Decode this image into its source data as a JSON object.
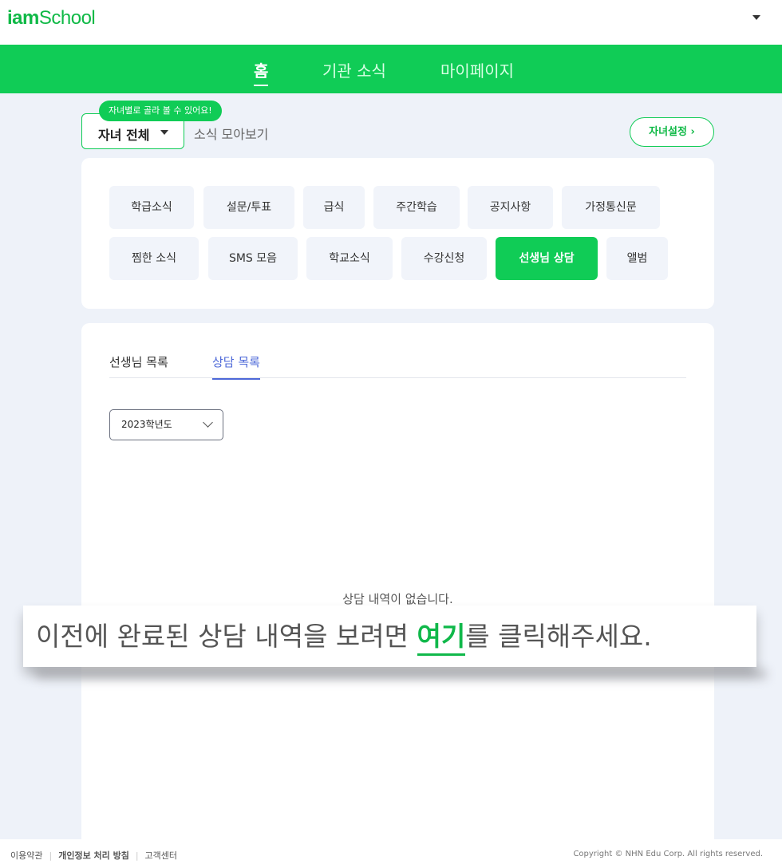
{
  "brand": {
    "logo_bold": "iam",
    "logo_regular": "School"
  },
  "gnb": {
    "items": [
      "홈",
      "기관 소식",
      "마이페이지"
    ],
    "active_index": 0
  },
  "selector": {
    "tooltip": "자녀별로 골라 볼 수 있어요!",
    "child_select": "자녀 전체",
    "news_collection": "소식 모아보기",
    "child_settings": "자녀설정 ›"
  },
  "categories": {
    "row1": [
      "학급소식",
      "설문/투표",
      "급식",
      "주간학습",
      "공지사항",
      "가정통신문"
    ],
    "row2": [
      "찜한 소식",
      "SMS 모음",
      "학교소식",
      "수강신청",
      "선생님 상담",
      "앨범"
    ],
    "active": "선생님 상담"
  },
  "consult": {
    "tabs": [
      "선생님 목록",
      "상담 목록"
    ],
    "active_tab": "상담 목록",
    "year_select": "2023학년도",
    "empty_message": "상담 내역이 없습니다."
  },
  "callout": {
    "prefix": "이전에 완료된 상담 내역을 보려면 ",
    "link": "여기",
    "suffix": "를 클릭해주세요."
  },
  "footer": {
    "links": [
      "이용약관",
      "개인정보 처리 방침",
      "고객센터"
    ],
    "copyright": "Copyright © NHN Edu Corp. All rights reserved."
  },
  "colors": {
    "brand_green": "#10cc56",
    "tab_blue": "#4d68d8",
    "background": "#eef2f9"
  }
}
